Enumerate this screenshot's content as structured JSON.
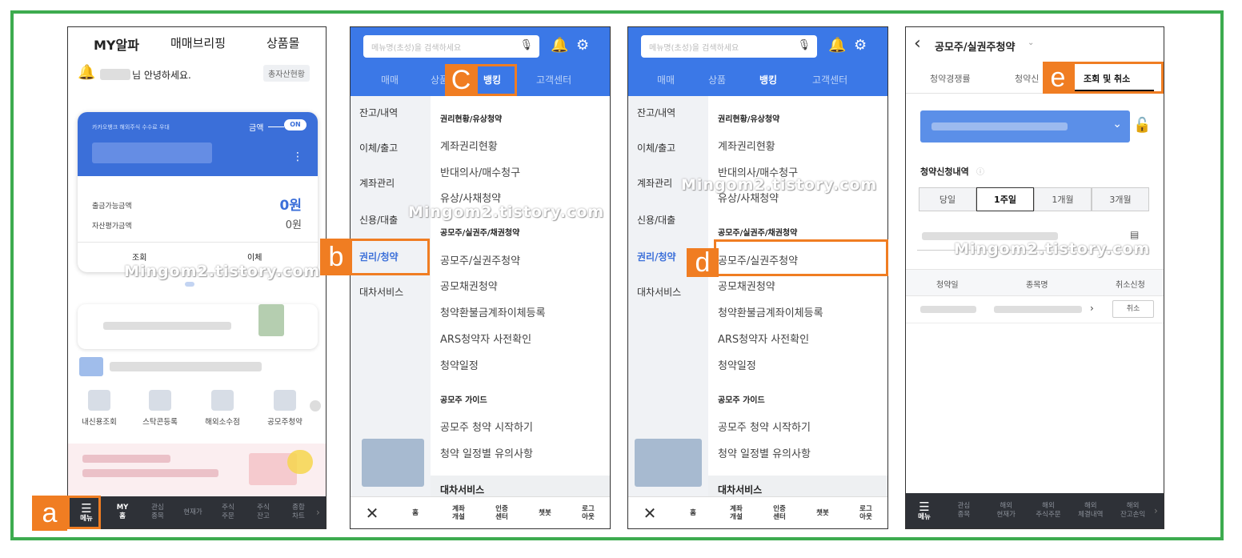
{
  "phone1": {
    "tabs": [
      "MY알파",
      "매매브리핑",
      "상품몰"
    ],
    "greeting": "님 안녕하세요.",
    "total_asset_button": "총자산현황",
    "card_note": "카카오뱅크 해외주식 수수료 우대",
    "amount_label": "금액",
    "amount_toggle": "ON",
    "withdrawable_label": "출금가능금액",
    "withdrawable_value": "0원",
    "asset_eval_label": "자산평가금액",
    "asset_eval_value": "0원",
    "inquiry_button": "조회",
    "transfer_button": "이체",
    "quick_links": [
      "내신용조회",
      "스탁콘등록",
      "해외소수점",
      "공모주청약"
    ],
    "bottom_bar": [
      {
        "l1": "메뉴",
        "l2": ""
      },
      {
        "l1": "MY",
        "l2": "홈"
      },
      {
        "l1": "관심",
        "l2": "종목"
      },
      {
        "l1": "현재가",
        "l2": ""
      },
      {
        "l1": "주식",
        "l2": "주문"
      },
      {
        "l1": "주식",
        "l2": "잔고"
      },
      {
        "l1": "종합",
        "l2": "차트"
      }
    ]
  },
  "menu": {
    "search_placeholder": "메뉴명(초성)을 검색하세요",
    "tabs": [
      "매매",
      "상품",
      "뱅킹",
      "고객센터"
    ],
    "left_items": [
      "잔고/내역",
      "이체/출고",
      "계좌관리",
      "신용/대출",
      "권리/청약",
      "대차서비스"
    ],
    "section1_title": "권리현황/유상청약",
    "section1_items": [
      "계좌권리현황",
      "반대의사/매수청구",
      "유상/사채청약"
    ],
    "section2_title": "공모주/실권주/채권청약",
    "section2_items": [
      "공모주/실권주청약",
      "공모채권청약",
      "청약환불금계좌이체등록",
      "ARS청약자 사전확인",
      "청약일정"
    ],
    "section3_title": "공모주 가이드",
    "section3_items": [
      "공모주 청약 시작하기",
      "청약 일정별 유의사항"
    ],
    "section4_title": "대차서비스",
    "bottom": [
      {
        "l1": "✕",
        "l2": ""
      },
      {
        "l1": "홈",
        "l2": ""
      },
      {
        "l1": "계좌",
        "l2": "개설"
      },
      {
        "l1": "인증",
        "l2": "센터"
      },
      {
        "l1": "챗봇",
        "l2": ""
      },
      {
        "l1": "로그",
        "l2": "아웃"
      }
    ]
  },
  "phone4": {
    "title": "공모주/실권주청약",
    "tabs": [
      "청약경쟁률",
      "청약신",
      "조회 및 취소"
    ],
    "history_title": "청약신청내역",
    "periods": [
      "당일",
      "1주일",
      "1개월",
      "3개월"
    ],
    "col_headers": [
      "청약일",
      "종목명",
      "취소신청"
    ],
    "cancel_button": "취소",
    "bottom_bar": [
      {
        "l1": "메뉴",
        "l2": ""
      },
      {
        "l1": "관심",
        "l2": "종목"
      },
      {
        "l1": "해외",
        "l2": "현재가"
      },
      {
        "l1": "해외",
        "l2": "주식주문"
      },
      {
        "l1": "해외",
        "l2": "체결내역"
      },
      {
        "l1": "해외",
        "l2": "잔고손익"
      }
    ]
  },
  "callouts": {
    "a": "a",
    "b": "b",
    "c": "C",
    "d": "d",
    "e": "e"
  },
  "watermark": "Mingom2.tistory.com",
  "colors": {
    "accent_blue": "#3b78e7",
    "callout_orange": "#f07d22",
    "frame_green": "#3dab4f"
  }
}
